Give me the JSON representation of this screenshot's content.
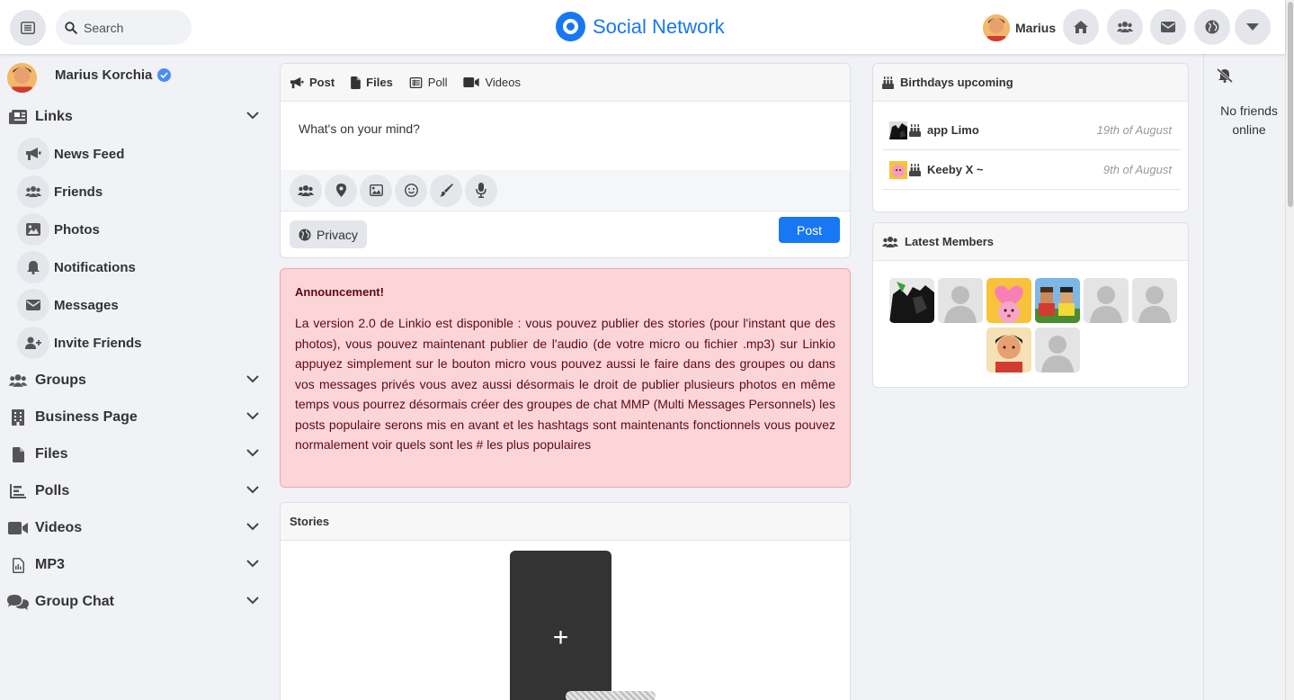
{
  "header": {
    "search_placeholder": "Search",
    "brand": "Social Network",
    "user_name": "Marius",
    "brand_color": "#1877f2"
  },
  "sidebar": {
    "profile_name": "Marius Korchia",
    "sections": [
      {
        "label": "Links"
      },
      {
        "label": "Groups"
      },
      {
        "label": "Business Page"
      },
      {
        "label": "Files"
      },
      {
        "label": "Polls"
      },
      {
        "label": "Videos"
      },
      {
        "label": "MP3"
      },
      {
        "label": "Group Chat"
      }
    ],
    "links": [
      {
        "label": "News Feed",
        "icon": "megaphone-icon"
      },
      {
        "label": "Friends",
        "icon": "users-icon"
      },
      {
        "label": "Photos",
        "icon": "image-icon"
      },
      {
        "label": "Notifications",
        "icon": "bell-icon"
      },
      {
        "label": "Messages",
        "icon": "envelope-icon"
      },
      {
        "label": "Invite Friends",
        "icon": "user-plus-icon"
      }
    ]
  },
  "composer": {
    "tabs": [
      "Post",
      "Files",
      "Poll",
      "Videos"
    ],
    "placeholder": "What's on your mind?",
    "privacy_label": "Privacy",
    "post_label": "Post"
  },
  "announcement": {
    "title": "Announcement!",
    "body": "La version 2.0 de Linkio est disponible : vous pouvez publier des stories (pour l'instant que des photos), vous pouvez maintenant publier de l'audio (de votre micro ou fichier .mp3) sur Linkio appuyez simplement sur le bouton micro vous pouvez aussi le faire dans des groupes ou dans vos messages privés vous avez aussi désormais le droit de publier plusieurs photos en même temps vous pourrez désormais créer des groupes de chat MMP (Multi Messages Personnels) les posts populaire serons mis en avant et les hashtags sont maintenants fonctionnels vous pouvez normalement voir quels sont les # les plus populaires"
  },
  "stories": {
    "title": "Stories",
    "add_label": "+"
  },
  "birthdays": {
    "title": "Birthdays upcoming",
    "items": [
      {
        "name": "app Limo",
        "date": "19th of August"
      },
      {
        "name": "Keeby X ~",
        "date": "9th of August"
      }
    ]
  },
  "latest_members": {
    "title": "Latest Members"
  },
  "online": {
    "text": "No friends online"
  }
}
